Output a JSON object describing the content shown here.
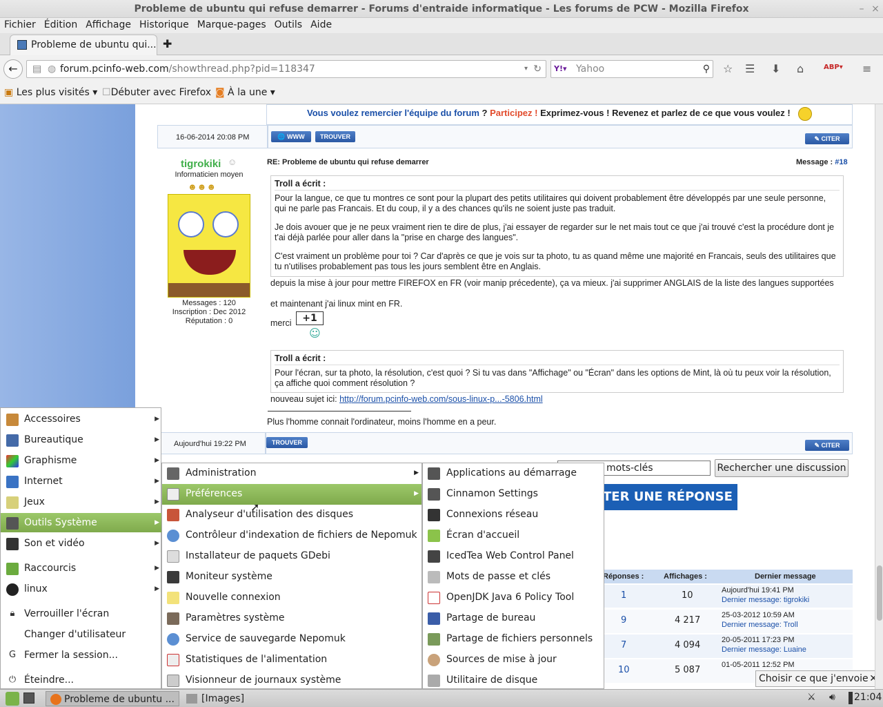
{
  "window": {
    "title": "Probleme de ubuntu qui refuse demarrer - Forums d'entraide informatique - Les forums de PCW - Mozilla Firefox"
  },
  "menubar": [
    "Fichier",
    "Édition",
    "Affichage",
    "Historique",
    "Marque-pages",
    "Outils",
    "Aide"
  ],
  "tab": {
    "label": "Probleme de ubuntu qui..."
  },
  "nav": {
    "url_host": "forum.pcinfo-web.com",
    "url_path": "/showthread.php?pid=118347",
    "search_placeholder": "Yahoo"
  },
  "bookmarks": [
    "Les plus visités ▾",
    "Débuter avec Firefox",
    "À la une ▾"
  ],
  "forum": {
    "banner_a": "Vous voulez remercier l'équipe du forum",
    "banner_q": " ? ",
    "banner_b": "Participez !",
    "banner_c": " Exprimez-vous ! Revenez et parlez de ce que vous voulez !",
    "prev_date": "16-06-2014 20:08 PM",
    "btn_www": "WWW",
    "btn_trouver": "TROUVER",
    "btn_citer": "CITER",
    "author": "tigrokiki",
    "rank": "Informaticien moyen",
    "messages": "Messages : 120",
    "inscription": "Inscription : Dec 2012",
    "reputation": "Réputation : 0",
    "post_title": "RE: Probleme de ubuntu qui refuse demarrer",
    "message_label": "Message : ",
    "message_num": "#18",
    "quote1_title": "Troll a écrit :",
    "quote1_p1": "Pour la langue, ce que tu montres ce sont pour la plupart des petits utilitaires qui doivent probablement être développés par une seule personne, qui ne parle pas Francais. Et du coup, il y a des chances qu'ils ne soient juste pas traduit.",
    "quote1_p2": "Je dois avouer que je ne peux vraiment rien te dire de plus, j'ai essayer de regarder sur le net mais tout ce que j'ai trouvé c'est la procédure dont je t'ai déjà parlée pour aller dans la \"prise en charge des langues\".",
    "quote1_p3": "C'est vraiment un problème pour toi ? Car d'après ce que je vois sur ta photo, tu as quand même une majorité en Francais, seuls des utilitaires que tu n'utilises probablement pas tous les jours semblent être en Anglais.",
    "body1": "depuis la mise à jour pour mettre FIREFOX en FR (voir manip précedente), ça va mieux. j'ai supprimer ANGLAIS de la liste des langues supportées",
    "body2": "et maintenant j'ai linux mint en FR.",
    "merci": "merci",
    "plus_one": "+1",
    "quote2_title": "Troll a écrit :",
    "quote2_p1": "Pour l'écran, sur ta photo, la résolution, c'est quoi ? Si tu vas dans \"Affichage\" ou \"Écran\" dans les options de Mint, là où tu peux voir la résolution, ça affiche quoi comment résolution ?",
    "nouveau": "nouveau sujet ici: ",
    "nouveau_link": "http://forum.pcinfo-web.com/sous-linux-p...-5806.html",
    "signature": "Plus l'homme connait l'ordinateur, moins l'homme en a peur.",
    "post_date": "Aujourd'hui 19:22 PM",
    "search_value": "mots-clés",
    "search_btn": "Rechercher une discussion",
    "reply_btn": "TER UNE RÉPONSE",
    "col_reponses": "Réponses :",
    "col_affichages": "Affichages :",
    "col_dernier": "Dernier message",
    "rows": [
      {
        "rep": "1",
        "aff": "10",
        "date": "Aujourd'hui 19:41 PM",
        "by": "tigrokiki"
      },
      {
        "rep": "9",
        "aff": "4 217",
        "date": "25-03-2012 10:59 AM",
        "by": "Troll"
      },
      {
        "rep": "7",
        "aff": "4 094",
        "date": "20-05-2011 17:23 PM",
        "by": "Luaine"
      },
      {
        "rep": "10",
        "aff": "5 087",
        "date": "01-05-2011 12:52 PM",
        "by": ""
      }
    ],
    "dernier_label": "Dernier message: ",
    "choisir": "Choisir ce que j'envoie"
  },
  "startmenu": {
    "categories": [
      "Accessoires",
      "Bureautique",
      "Graphisme",
      "Internet",
      "Jeux",
      "Outils Système",
      "Son et vidéo",
      "Raccourcis",
      "linux"
    ],
    "actions": [
      "Verrouiller l'écran",
      "Changer d'utilisateur",
      "Fermer la session...",
      "Éteindre..."
    ]
  },
  "submenu1": [
    "Administration",
    "Préférences",
    "Analyseur d'utilisation des disques",
    "Contrôleur d'indexation de fichiers de Nepomuk",
    "Installateur de paquets GDebi",
    "Moniteur système",
    "Nouvelle connexion",
    "Paramètres système",
    "Service de sauvegarde Nepomuk",
    "Statistiques de l'alimentation",
    "Visionneur de journaux système"
  ],
  "submenu2": [
    "Applications au démarrage",
    "Cinnamon Settings",
    "Connexions réseau",
    "Écran d'accueil",
    "IcedTea Web Control Panel",
    "Mots de passe et clés",
    "OpenJDK Java 6 Policy Tool",
    "Partage de bureau",
    "Partage de fichiers personnels",
    "Sources de mise à jour",
    "Utilitaire de disque"
  ],
  "taskbar": {
    "task1": "Probleme de ubuntu ...",
    "task2": "[Images]",
    "clock": "21:04"
  }
}
